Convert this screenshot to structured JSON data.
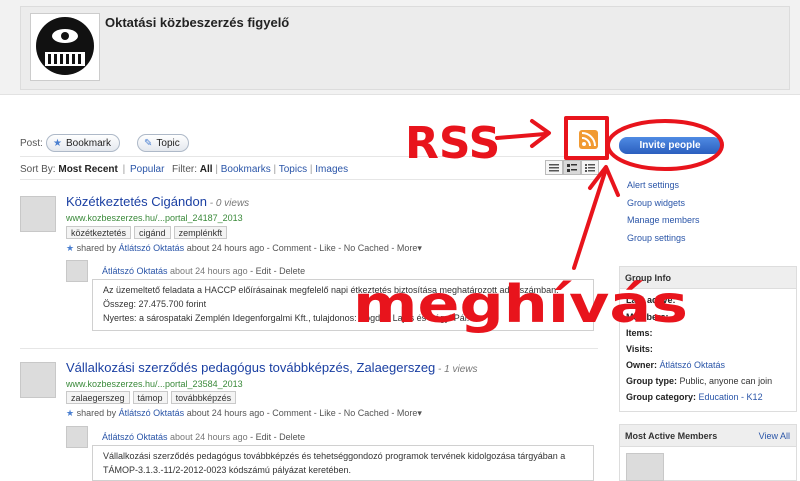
{
  "header": {
    "title": "Oktatási közbeszerzés figyelő"
  },
  "toolbar": {
    "post_label": "Post:",
    "bookmark_label": "Bookmark",
    "topic_label": "Topic"
  },
  "sort": {
    "label": "Sort By:",
    "most_recent": "Most Recent",
    "popular": "Popular"
  },
  "filter": {
    "label": "Filter:",
    "all": "All",
    "bookmarks": "Bookmarks",
    "topics": "Topics",
    "images": "Images"
  },
  "items": [
    {
      "title": "Közétkeztetés Cigándon",
      "views": " - 0 views",
      "url": "www.kozbeszerzes.hu/...portal_24187_2013",
      "tags": [
        "közétkeztetés",
        "cigánd",
        "zemplénkft"
      ],
      "meta": {
        "shared_by": "shared by",
        "author": "Átlátszó Oktatás",
        "time": "about 24 hours ago",
        "actions": "- Comment - Like - No Cached - More"
      },
      "comment": {
        "author": "Átlátszó Oktatás",
        "time": "about 24 hours ago",
        "actions": "- Edit - Delete",
        "lines": [
          "Az üzemeltető feladata a HACCP előírásainak megfelelő napi étkeztetés biztosítása meghatározott adagszámban.",
          "Összeg: 27.475.700 forint",
          "Nyertes: a sárospataki Zemplén Idegenforgalmi Kft., tulajdonos: Bogdán Lajos és Bágyi Pál."
        ]
      }
    },
    {
      "title": "Vállalkozási szerződés pedagógus továbbképzés, Zalaegerszeg",
      "views": " - 1 views",
      "url": "www.kozbeszerzes.hu/...portal_23584_2013",
      "tags": [
        "zalaegerszeg",
        "támop",
        "továbbképzés"
      ],
      "meta": {
        "shared_by": "shared by",
        "author": "Átlátszó Oktatás",
        "time": "about 24 hours ago",
        "actions": "- Comment - Like - No Cached - More"
      },
      "comment": {
        "author": "Átlátszó Oktatás",
        "time": "about 24 hours ago",
        "actions": "- Edit - Delete",
        "lines": [
          "Vállalkozási szerződés pedagógus továbbképzés és tehetséggondozó programok tervének kidolgozása tárgyában a",
          "TÁMOP-3.1.3.-11/2-2012-0023 kódszámú pályázat keretében."
        ]
      }
    }
  ],
  "sidebar": {
    "invite": "Invite people",
    "links": [
      "Alert settings",
      "Group widgets",
      "Manage members",
      "Group settings"
    ],
    "info_title": "Group Info",
    "info": {
      "last_active": "Last active:",
      "members": "Members:",
      "items": "Items:",
      "visits": "Visits:",
      "owner_label": "Owner:",
      "owner": "Átlátszó Oktatás",
      "type_label": "Group type:",
      "type": "Public, anyone can join",
      "category_label": "Group category:",
      "category": "Education - K12"
    },
    "members_title": "Most Active Members",
    "view_all": "View All"
  },
  "annotations": {
    "rss_text": "RSS",
    "meghivas_text": "meghívás",
    "color": "#e8141c"
  },
  "icons": {
    "rss": "rss-feed-icon",
    "bookmark": "bookmark-icon",
    "topic": "topic-bubble-icon"
  }
}
